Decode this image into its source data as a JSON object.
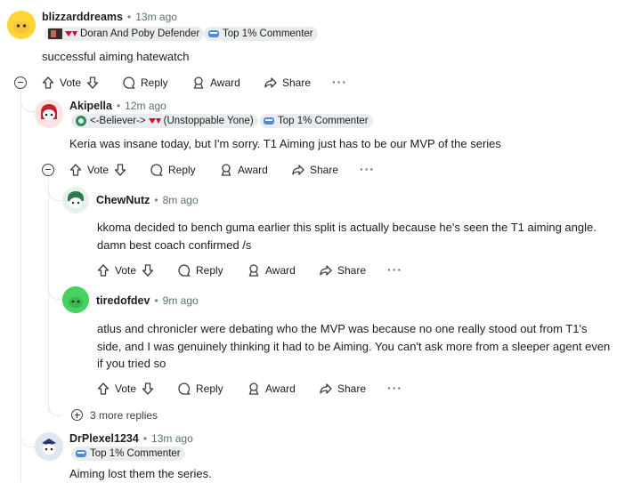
{
  "comments": [
    {
      "id": "c1",
      "username": "blizzarddreams",
      "time": "13m ago",
      "flairs": [
        "Doran And Poby Defender",
        "Top 1% Commenter"
      ],
      "body": [
        "successful aiming hatewatch"
      ],
      "actions": {
        "vote": "Vote",
        "reply": "Reply",
        "award": "Award",
        "share": "Share"
      }
    },
    {
      "id": "c2",
      "username": "Akipella",
      "time": "12m ago",
      "flairs": [
        "<-Believer->",
        "(Unstoppable Yone)",
        "Top 1% Commenter"
      ],
      "body": [
        "Keria was insane today, but I'm sorry. T1 Aiming just has to be our MVP of the series"
      ],
      "actions": {
        "vote": "Vote",
        "reply": "Reply",
        "award": "Award",
        "share": "Share"
      }
    },
    {
      "id": "c3",
      "username": "ChewNutz",
      "time": "8m ago",
      "body": [
        "kkoma decided to bench guma earlier this split is actually because he's seen the T1 aiming angle.",
        "damn best coach confirmed /s"
      ],
      "actions": {
        "vote": "Vote",
        "reply": "Reply",
        "award": "Award",
        "share": "Share"
      }
    },
    {
      "id": "c4",
      "username": "tiredofdev",
      "time": "9m ago",
      "body": [
        "atlus and chronicler were debating who the MVP was because no one really stood out from T1's",
        "side, and I was genuinely thinking it had to be Aiming. You can't ask more from a sleeper agent even",
        "if you tried so"
      ],
      "actions": {
        "vote": "Vote",
        "reply": "Reply",
        "award": "Award",
        "share": "Share"
      }
    },
    {
      "id": "c5",
      "username": "DrPlexel1234",
      "time": "13m ago",
      "flairs": [
        "Top 1% Commenter"
      ],
      "body": [
        "Aiming lost them the series."
      ]
    }
  ],
  "more_replies": "3 more replies",
  "separator": "•",
  "colors": {
    "text": "#1c1c1c",
    "muted": "#576f76",
    "flair_bg": "#eaedef",
    "t1_red": "#e2012d"
  }
}
